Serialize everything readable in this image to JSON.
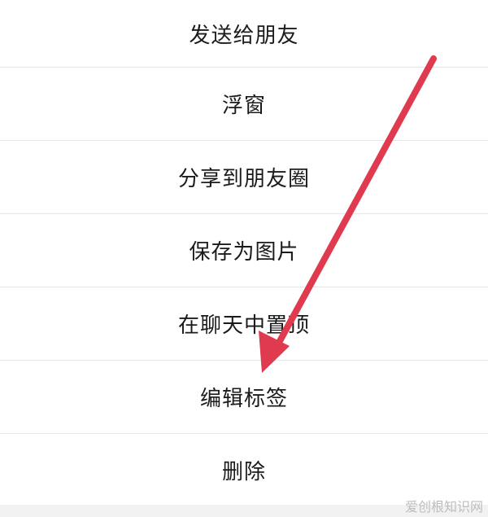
{
  "menu": {
    "items": [
      {
        "label": "发送给朋友"
      },
      {
        "label": "浮窗"
      },
      {
        "label": "分享到朋友圈"
      },
      {
        "label": "保存为图片"
      },
      {
        "label": "在聊天中置顶"
      },
      {
        "label": "编辑标签"
      },
      {
        "label": "删除"
      }
    ]
  },
  "watermark": {
    "text": "爱创根知识网"
  },
  "annotation": {
    "arrow_color": "#e03a4e"
  }
}
